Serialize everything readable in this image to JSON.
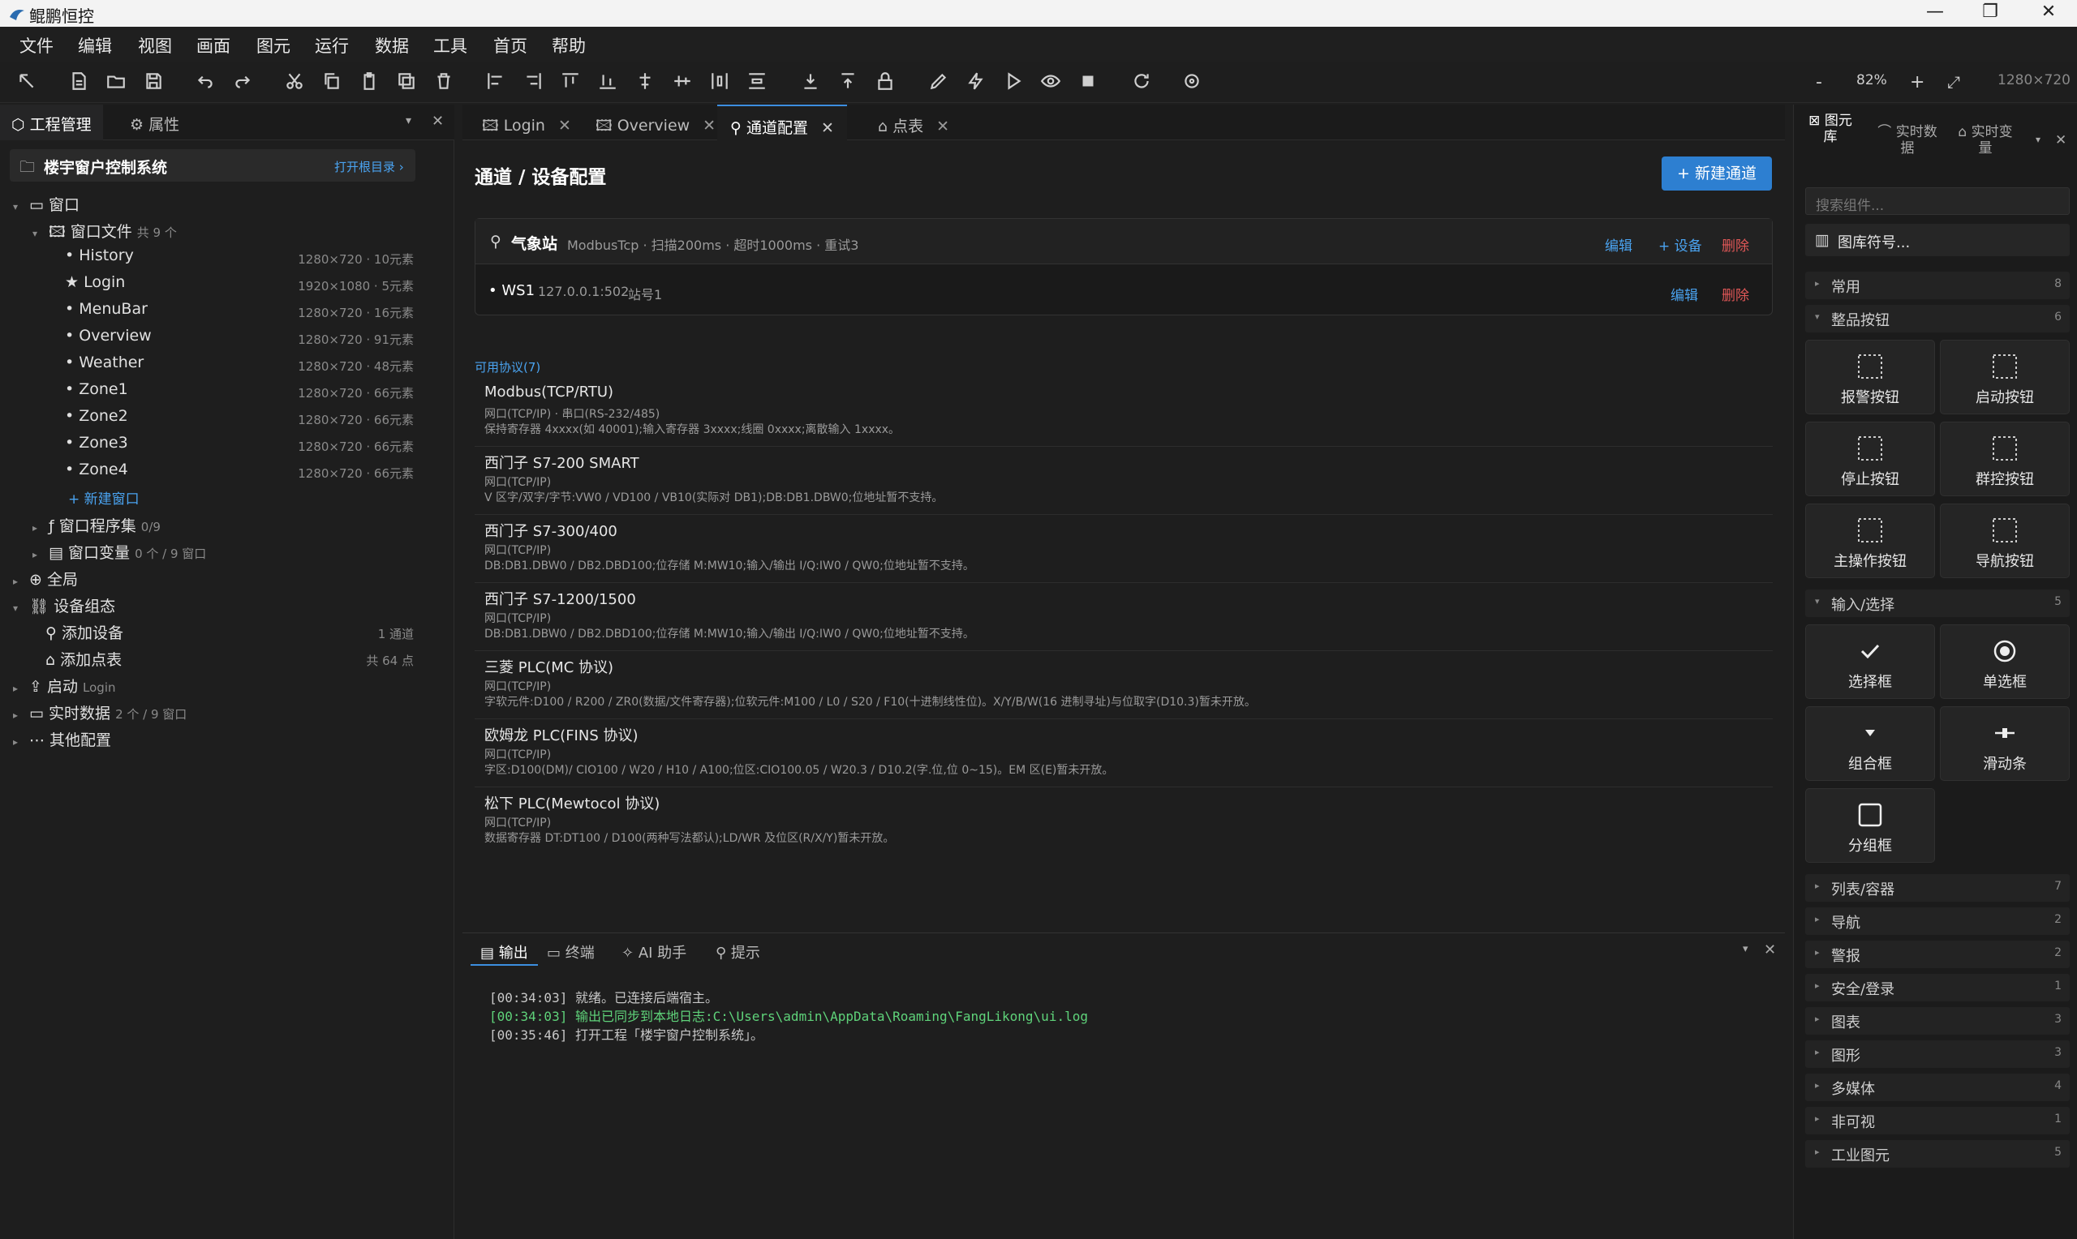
{
  "window": {
    "title": "鲲鹏恒控",
    "min": "—",
    "max": "❐",
    "close": "✕"
  },
  "menu": [
    "文件",
    "编辑",
    "视图",
    "画面",
    "图元",
    "运行",
    "数据",
    "工具",
    "首页",
    "帮助"
  ],
  "toolbar": {
    "zoom_out": "-",
    "zoom": "82%",
    "zoom_in": "+",
    "fit": "⤢",
    "size": "1280×720"
  },
  "left_tabs": {
    "project": "工程管理",
    "props": "属性",
    "dropdown": "▾",
    "close": "✕"
  },
  "project": {
    "name": "楼宇窗户控制系统",
    "open_dir": "打开根目录 ›"
  },
  "tree": {
    "windows": "窗口",
    "window_files": "窗口文件",
    "window_files_count": "共 9 个",
    "files": [
      {
        "name": "History",
        "info": "1280×720 · 10元素",
        "star": false
      },
      {
        "name": "Login",
        "info": "1920×1080 · 5元素",
        "star": true
      },
      {
        "name": "MenuBar",
        "info": "1280×720 · 16元素",
        "star": false
      },
      {
        "name": "Overview",
        "info": "1280×720 · 91元素",
        "star": false
      },
      {
        "name": "Weather",
        "info": "1280×720 · 48元素",
        "star": false
      },
      {
        "name": "Zone1",
        "info": "1280×720 · 66元素",
        "star": false
      },
      {
        "name": "Zone2",
        "info": "1280×720 · 66元素",
        "star": false
      },
      {
        "name": "Zone3",
        "info": "1280×720 · 66元素",
        "star": false
      },
      {
        "name": "Zone4",
        "info": "1280×720 · 66元素",
        "star": false
      }
    ],
    "new_window": "+ 新建窗口",
    "scripts": "窗口程序集",
    "scripts_count": "0/9",
    "vars": "窗口变量",
    "vars_count": "0 个 / 9 窗口",
    "global": "全局",
    "device": "设备组态",
    "add_device": "添加设备",
    "add_device_count": "1 通道",
    "add_points": "添加点表",
    "add_points_count": "共 64 点",
    "startup": "启动",
    "startup_meta": "Login",
    "realtime": "实时数据",
    "realtime_meta": "2 个 / 9 窗口",
    "other": "其他配置"
  },
  "doc_tabs": [
    "Login",
    "Overview",
    "通道配置",
    "点表"
  ],
  "page": {
    "title": "通道 / 设备配置",
    "new_channel": "+ 新建通道"
  },
  "channel": {
    "name": "气象站",
    "meta": "ModbusTcp · 扫描200ms · 超时1000ms · 重试3",
    "edit": "编辑",
    "add_device": "+ 设备",
    "delete": "删除",
    "device": {
      "name": "• WS1",
      "addr": "127.0.0.1:502",
      "station": "站号1",
      "edit": "编辑",
      "delete": "删除"
    }
  },
  "protocols_title": "可用协议(7)",
  "protocols": [
    {
      "name": "Modbus(TCP/RTU)",
      "sub": "网口(TCP/IP) · 串口(RS-232/485)",
      "desc": "保持寄存器 4xxxx(如 40001);输入寄存器 3xxxx;线圈 0xxxx;离散输入 1xxxx。"
    },
    {
      "name": "西门子 S7-200 SMART",
      "sub": "网口(TCP/IP)",
      "desc": "V 区字/双字/字节:VW0 / VD100 / VB10(实际对 DB1);DB:DB1.DBW0;位地址暂不支持。"
    },
    {
      "name": "西门子 S7-300/400",
      "sub": "网口(TCP/IP)",
      "desc": "DB:DB1.DBW0 / DB2.DBD100;位存储 M:MW10;输入/输出 I/Q:IW0 / QW0;位地址暂不支持。"
    },
    {
      "name": "西门子 S7-1200/1500",
      "sub": "网口(TCP/IP)",
      "desc": "DB:DB1.DBW0 / DB2.DBD100;位存储 M:MW10;输入/输出 I/Q:IW0 / QW0;位地址暂不支持。"
    },
    {
      "name": "三菱 PLC(MC 协议)",
      "sub": "网口(TCP/IP)",
      "desc": "字软元件:D100 / R200 / ZR0(数据/文件寄存器);位软元件:M100 / L0 / S20 / F10(十进制线性位)。X/Y/B/W(16 进制寻址)与位取字(D10.3)暂未开放。"
    },
    {
      "name": "欧姆龙 PLC(FINS 协议)",
      "sub": "网口(TCP/IP)",
      "desc": "字区:D100(DM)/ CIO100 / W20 / H10 / A100;位区:CIO100.05 / W20.3 / D10.2(字.位,位 0~15)。EM 区(E)暂未开放。"
    },
    {
      "name": "松下 PLC(Mewtocol 协议)",
      "sub": "网口(TCP/IP)",
      "desc": "数据寄存器 DT:DT100 / D100(两种写法都认);LD/WR 及位区(R/X/Y)暂未开放。"
    }
  ],
  "output": {
    "tabs": [
      "输出",
      "终端",
      "AI 助手",
      "提示"
    ],
    "logs": [
      {
        "time": "[00:34:03]",
        "msg": "就绪。已连接后端宿主。",
        "color": "#c8c8c8"
      },
      {
        "time": "[00:34:03]",
        "msg": "输出已同步到本地日志:C:\\Users\\admin\\AppData\\Roaming\\FangLikong\\ui.log",
        "color": "#5fd37a"
      },
      {
        "time": "[00:35:46]",
        "msg": "打开工程「楼宇窗户控制系统」。",
        "color": "#c8c8c8"
      }
    ]
  },
  "right_tabs": {
    "lib": "图元库",
    "rt_data": "实时数据",
    "rt_var": "实时变量"
  },
  "library": {
    "search_placeholder": "搜索组件...",
    "symbols": "图库符号...",
    "categories": [
      {
        "name": "常用",
        "count": "8"
      },
      {
        "name": "整品按钮",
        "count": "6"
      },
      {
        "name": "输入/选择",
        "count": "5"
      },
      {
        "name": "列表/容器",
        "count": "7"
      },
      {
        "name": "导航",
        "count": "2"
      },
      {
        "name": "警报",
        "count": "2"
      },
      {
        "name": "安全/登录",
        "count": "1"
      },
      {
        "name": "图表",
        "count": "3"
      },
      {
        "name": "图形",
        "count": "3"
      },
      {
        "name": "多媒体",
        "count": "4"
      },
      {
        "name": "非可视",
        "count": "1"
      },
      {
        "name": "工业图元",
        "count": "5"
      }
    ],
    "buttons": [
      "报警按钮",
      "启动按钮",
      "停止按钮",
      "群控按钮",
      "主操作按钮",
      "导航按钮"
    ],
    "inputs": [
      "选择框",
      "单选框",
      "组合框",
      "滑动条",
      "分组框"
    ]
  }
}
